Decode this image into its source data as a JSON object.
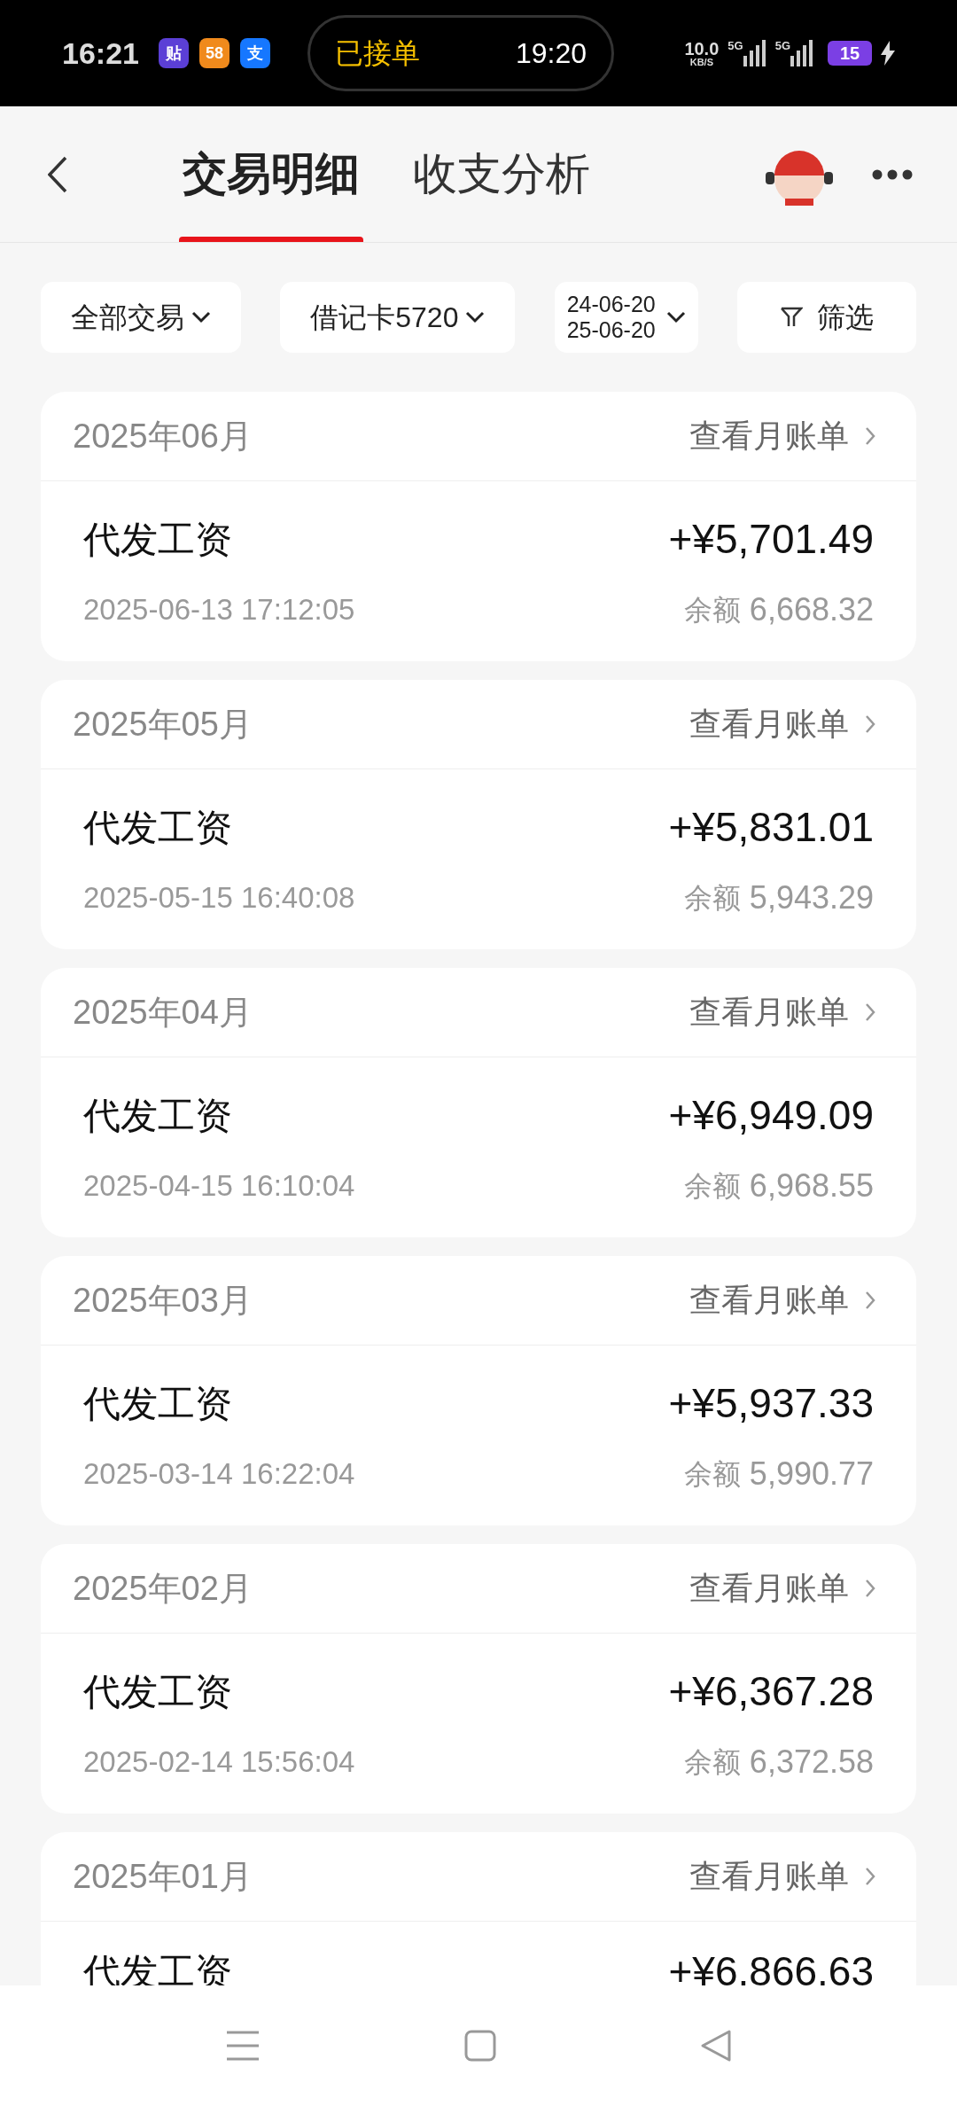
{
  "status_bar": {
    "time": "16:21",
    "app_icons": [
      {
        "label": "贴",
        "color": "#5b3fd6"
      },
      {
        "label": "58",
        "color": "#f08a1c"
      },
      {
        "label": "支",
        "color": "#1677ff"
      }
    ],
    "pill_status": "已接单",
    "pill_time": "19:20",
    "net_speed": "10.0",
    "net_unit": "KB/S",
    "network_1": "5G",
    "network_2": "5G",
    "battery": "15"
  },
  "header": {
    "tabs": [
      {
        "label": "交易明细",
        "selected": true
      },
      {
        "label": "收支分析",
        "selected": false
      }
    ]
  },
  "filters": [
    {
      "kind": "dropdown",
      "label": "全部交易"
    },
    {
      "kind": "dropdown",
      "label": "借记卡5720"
    },
    {
      "kind": "range",
      "from": "24-06-20",
      "to": "25-06-20"
    },
    {
      "kind": "filter",
      "label": "筛选"
    }
  ],
  "months": [
    {
      "month": "2025年06月",
      "link": "查看月账单",
      "title": "代发工资",
      "amount": "+¥5,701.49",
      "time": "2025-06-13 17:12:05",
      "balance_label": "余额",
      "balance": "6,668.32"
    },
    {
      "month": "2025年05月",
      "link": "查看月账单",
      "title": "代发工资",
      "amount": "+¥5,831.01",
      "time": "2025-05-15 16:40:08",
      "balance_label": "余额",
      "balance": "5,943.29"
    },
    {
      "month": "2025年04月",
      "link": "查看月账单",
      "title": "代发工资",
      "amount": "+¥6,949.09",
      "time": "2025-04-15 16:10:04",
      "balance_label": "余额",
      "balance": "6,968.55"
    },
    {
      "month": "2025年03月",
      "link": "查看月账单",
      "title": "代发工资",
      "amount": "+¥5,937.33",
      "time": "2025-03-14 16:22:04",
      "balance_label": "余额",
      "balance": "5,990.77"
    },
    {
      "month": "2025年02月",
      "link": "查看月账单",
      "title": "代发工资",
      "amount": "+¥6,367.28",
      "time": "2025-02-14 15:56:04",
      "balance_label": "余额",
      "balance": "6,372.58"
    },
    {
      "month": "2025年01月",
      "link": "查看月账单",
      "title": "代发工资",
      "amount": "+¥6,866.63"
    }
  ]
}
